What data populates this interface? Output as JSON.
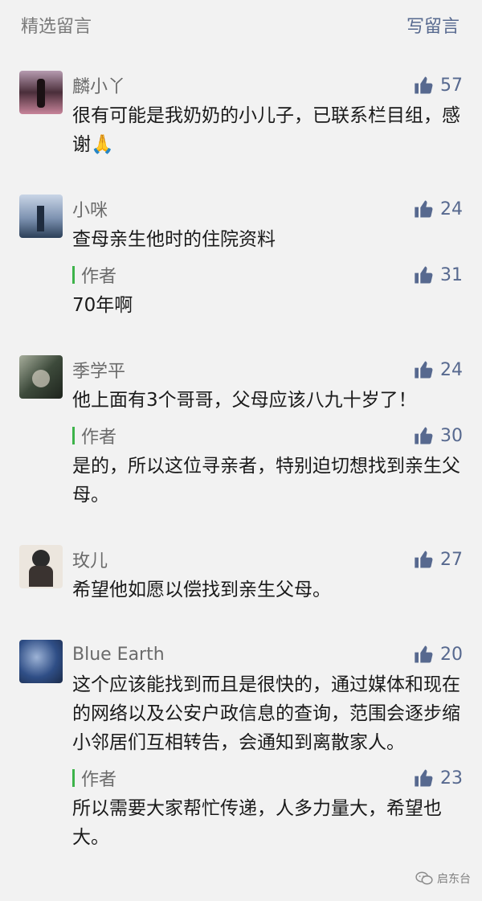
{
  "header": {
    "title": "精选留言",
    "write": "写留言"
  },
  "comments": [
    {
      "nick": "麟小丫",
      "likes": "57",
      "text": "很有可能是我奶奶的小儿子，已联系栏目组，感谢🙏",
      "avatar_colors": [
        "#4a2e3a",
        "#c7849a",
        "#2e1b24"
      ]
    },
    {
      "nick": "小咪",
      "likes": "24",
      "text": "查母亲生他时的住院资料",
      "avatar_colors": [
        "#5a6f8c",
        "#d9e1ec",
        "#2b3f58"
      ],
      "reply": {
        "label": "作者",
        "likes": "31",
        "text": "70年啊"
      }
    },
    {
      "nick": "季学平",
      "likes": "24",
      "text": "他上面有3个哥哥，父母应该八九十岁了！",
      "avatar_colors": [
        "#3d4a3b",
        "#a7ae9c",
        "#1e241d"
      ],
      "reply": {
        "label": "作者",
        "likes": "30",
        "text": "是的，所以这位寻亲者，特别迫切想找到亲生父母。"
      }
    },
    {
      "nick": "玫儿",
      "likes": "27",
      "text": "希望他如愿以偿找到亲生父母。",
      "avatar_colors": [
        "#f2ede6",
        "#2b2b2b",
        "#c9a882"
      ]
    },
    {
      "nick": "Blue Earth",
      "likes": "20",
      "text": "这个应该能找到而且是很快的，通过媒体和现在的网络以及公安户政信息的查询，范围会逐步缩小邻居们互相转告，会通知到离散家人。",
      "avatar_colors": [
        "#2f4e86",
        "#9db3d6",
        "#1b2b4a"
      ],
      "reply": {
        "label": "作者",
        "likes": "23",
        "text": "所以需要大家帮忙传递，人多力量大，希望也大。"
      }
    }
  ],
  "watermark": {
    "text": "启东台"
  },
  "colors": {
    "accent": "#57698f",
    "author_bar": "#3db34a",
    "background": "#f2f2f2"
  },
  "icons": {
    "like": "thumbs-up-icon",
    "watermark": "wechat-icon"
  }
}
